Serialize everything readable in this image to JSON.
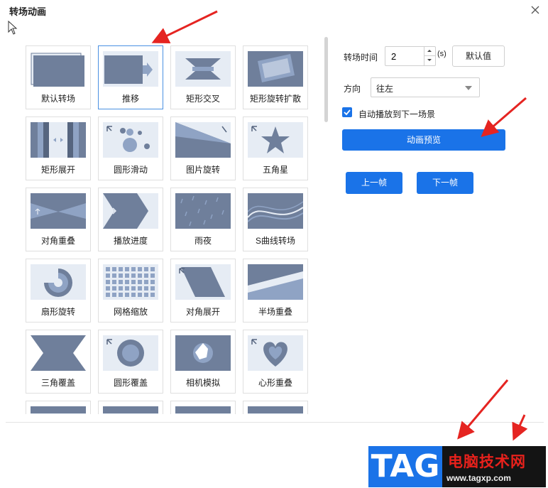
{
  "dialog": {
    "title": "转场动画"
  },
  "transitions": [
    {
      "label": "默认转场",
      "icon": "default-transition-icon",
      "selected": false
    },
    {
      "label": "推移",
      "icon": "push-icon",
      "selected": true
    },
    {
      "label": "矩形交叉",
      "icon": "rect-cross-icon",
      "selected": false
    },
    {
      "label": "矩形旋转扩散",
      "icon": "rect-rotate-spread-icon",
      "selected": false
    },
    {
      "label": "矩形展开",
      "icon": "rect-unfold-icon",
      "selected": false
    },
    {
      "label": "圆形滑动",
      "icon": "circle-slide-icon",
      "selected": false
    },
    {
      "label": "图片旋转",
      "icon": "image-rotate-icon",
      "selected": false
    },
    {
      "label": "五角星",
      "icon": "star-icon",
      "selected": false
    },
    {
      "label": "对角重叠",
      "icon": "diagonal-overlap-icon",
      "selected": false
    },
    {
      "label": "播放进度",
      "icon": "play-progress-icon",
      "selected": false
    },
    {
      "label": "雨夜",
      "icon": "rainy-night-icon",
      "selected": false
    },
    {
      "label": "S曲线转场",
      "icon": "s-curve-icon",
      "selected": false
    },
    {
      "label": "扇形旋转",
      "icon": "fan-rotate-icon",
      "selected": false
    },
    {
      "label": "网格缩放",
      "icon": "grid-zoom-icon",
      "selected": false
    },
    {
      "label": "对角展开",
      "icon": "diagonal-unfold-icon",
      "selected": false
    },
    {
      "label": "半场重叠",
      "icon": "half-overlap-icon",
      "selected": false
    },
    {
      "label": "三角覆盖",
      "icon": "triangle-cover-icon",
      "selected": false
    },
    {
      "label": "圆形覆盖",
      "icon": "circle-cover-icon",
      "selected": false
    },
    {
      "label": "相机模拟",
      "icon": "camera-sim-icon",
      "selected": false
    },
    {
      "label": "心形重叠",
      "icon": "heart-overlap-icon",
      "selected": false
    },
    {
      "label": "",
      "icon": "partial-tile-icon",
      "selected": false
    },
    {
      "label": "",
      "icon": "partial-tile-icon",
      "selected": false
    },
    {
      "label": "",
      "icon": "partial-tile-icon",
      "selected": false
    },
    {
      "label": "",
      "icon": "partial-tile-icon",
      "selected": false
    }
  ],
  "settings": {
    "duration_label": "转场时间",
    "duration_value": "2",
    "duration_unit": "(s)",
    "default_button": "默认值",
    "direction_label": "方向",
    "direction_value": "往左",
    "autoplay_label": "自动播放到下一场景",
    "autoplay_checked": true,
    "preview_button": "动画预览",
    "prev_frame_button": "上一帧",
    "next_frame_button": "下一帧"
  },
  "watermark": {
    "tag": "TAG",
    "site_name": "电脑技术网",
    "url": "www.tagxp.com"
  },
  "colors": {
    "accent": "#1a73e8",
    "thumb_bg": "#e6ecf4",
    "thumb_shape": "#6f7f9b",
    "arrow": "#e52421"
  }
}
